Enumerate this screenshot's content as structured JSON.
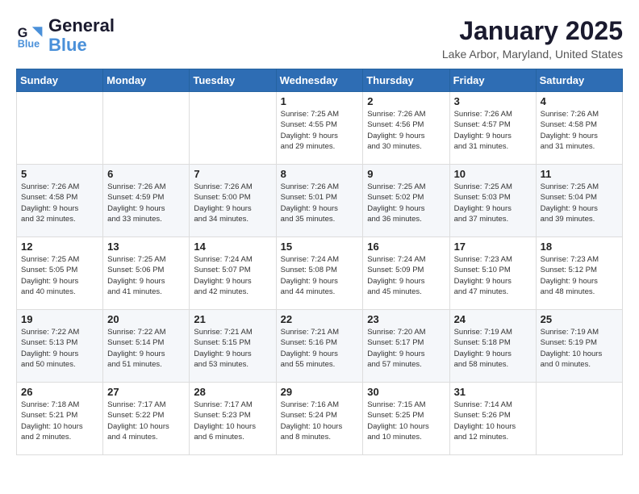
{
  "logo": {
    "text_general": "General",
    "text_blue": "Blue"
  },
  "header": {
    "month": "January 2025",
    "location": "Lake Arbor, Maryland, United States"
  },
  "weekdays": [
    "Sunday",
    "Monday",
    "Tuesday",
    "Wednesday",
    "Thursday",
    "Friday",
    "Saturday"
  ],
  "weeks": [
    [
      {
        "day": "",
        "info": ""
      },
      {
        "day": "",
        "info": ""
      },
      {
        "day": "",
        "info": ""
      },
      {
        "day": "1",
        "info": "Sunrise: 7:25 AM\nSunset: 4:55 PM\nDaylight: 9 hours\nand 29 minutes."
      },
      {
        "day": "2",
        "info": "Sunrise: 7:26 AM\nSunset: 4:56 PM\nDaylight: 9 hours\nand 30 minutes."
      },
      {
        "day": "3",
        "info": "Sunrise: 7:26 AM\nSunset: 4:57 PM\nDaylight: 9 hours\nand 31 minutes."
      },
      {
        "day": "4",
        "info": "Sunrise: 7:26 AM\nSunset: 4:58 PM\nDaylight: 9 hours\nand 31 minutes."
      }
    ],
    [
      {
        "day": "5",
        "info": "Sunrise: 7:26 AM\nSunset: 4:58 PM\nDaylight: 9 hours\nand 32 minutes."
      },
      {
        "day": "6",
        "info": "Sunrise: 7:26 AM\nSunset: 4:59 PM\nDaylight: 9 hours\nand 33 minutes."
      },
      {
        "day": "7",
        "info": "Sunrise: 7:26 AM\nSunset: 5:00 PM\nDaylight: 9 hours\nand 34 minutes."
      },
      {
        "day": "8",
        "info": "Sunrise: 7:26 AM\nSunset: 5:01 PM\nDaylight: 9 hours\nand 35 minutes."
      },
      {
        "day": "9",
        "info": "Sunrise: 7:25 AM\nSunset: 5:02 PM\nDaylight: 9 hours\nand 36 minutes."
      },
      {
        "day": "10",
        "info": "Sunrise: 7:25 AM\nSunset: 5:03 PM\nDaylight: 9 hours\nand 37 minutes."
      },
      {
        "day": "11",
        "info": "Sunrise: 7:25 AM\nSunset: 5:04 PM\nDaylight: 9 hours\nand 39 minutes."
      }
    ],
    [
      {
        "day": "12",
        "info": "Sunrise: 7:25 AM\nSunset: 5:05 PM\nDaylight: 9 hours\nand 40 minutes."
      },
      {
        "day": "13",
        "info": "Sunrise: 7:25 AM\nSunset: 5:06 PM\nDaylight: 9 hours\nand 41 minutes."
      },
      {
        "day": "14",
        "info": "Sunrise: 7:24 AM\nSunset: 5:07 PM\nDaylight: 9 hours\nand 42 minutes."
      },
      {
        "day": "15",
        "info": "Sunrise: 7:24 AM\nSunset: 5:08 PM\nDaylight: 9 hours\nand 44 minutes."
      },
      {
        "day": "16",
        "info": "Sunrise: 7:24 AM\nSunset: 5:09 PM\nDaylight: 9 hours\nand 45 minutes."
      },
      {
        "day": "17",
        "info": "Sunrise: 7:23 AM\nSunset: 5:10 PM\nDaylight: 9 hours\nand 47 minutes."
      },
      {
        "day": "18",
        "info": "Sunrise: 7:23 AM\nSunset: 5:12 PM\nDaylight: 9 hours\nand 48 minutes."
      }
    ],
    [
      {
        "day": "19",
        "info": "Sunrise: 7:22 AM\nSunset: 5:13 PM\nDaylight: 9 hours\nand 50 minutes."
      },
      {
        "day": "20",
        "info": "Sunrise: 7:22 AM\nSunset: 5:14 PM\nDaylight: 9 hours\nand 51 minutes."
      },
      {
        "day": "21",
        "info": "Sunrise: 7:21 AM\nSunset: 5:15 PM\nDaylight: 9 hours\nand 53 minutes."
      },
      {
        "day": "22",
        "info": "Sunrise: 7:21 AM\nSunset: 5:16 PM\nDaylight: 9 hours\nand 55 minutes."
      },
      {
        "day": "23",
        "info": "Sunrise: 7:20 AM\nSunset: 5:17 PM\nDaylight: 9 hours\nand 57 minutes."
      },
      {
        "day": "24",
        "info": "Sunrise: 7:19 AM\nSunset: 5:18 PM\nDaylight: 9 hours\nand 58 minutes."
      },
      {
        "day": "25",
        "info": "Sunrise: 7:19 AM\nSunset: 5:19 PM\nDaylight: 10 hours\nand 0 minutes."
      }
    ],
    [
      {
        "day": "26",
        "info": "Sunrise: 7:18 AM\nSunset: 5:21 PM\nDaylight: 10 hours\nand 2 minutes."
      },
      {
        "day": "27",
        "info": "Sunrise: 7:17 AM\nSunset: 5:22 PM\nDaylight: 10 hours\nand 4 minutes."
      },
      {
        "day": "28",
        "info": "Sunrise: 7:17 AM\nSunset: 5:23 PM\nDaylight: 10 hours\nand 6 minutes."
      },
      {
        "day": "29",
        "info": "Sunrise: 7:16 AM\nSunset: 5:24 PM\nDaylight: 10 hours\nand 8 minutes."
      },
      {
        "day": "30",
        "info": "Sunrise: 7:15 AM\nSunset: 5:25 PM\nDaylight: 10 hours\nand 10 minutes."
      },
      {
        "day": "31",
        "info": "Sunrise: 7:14 AM\nSunset: 5:26 PM\nDaylight: 10 hours\nand 12 minutes."
      },
      {
        "day": "",
        "info": ""
      }
    ]
  ]
}
